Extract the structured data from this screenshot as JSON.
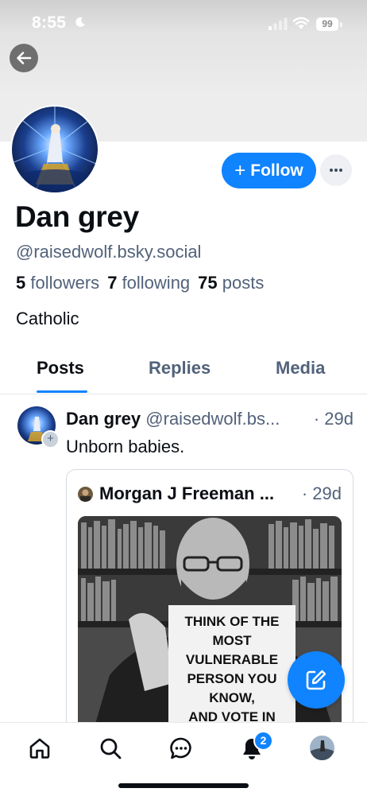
{
  "status_bar": {
    "time": "8:55",
    "battery": "99",
    "icons": [
      "moon-icon",
      "signal-icon",
      "wifi-icon",
      "battery-icon"
    ]
  },
  "header": {
    "back_icon": "arrow-left-icon"
  },
  "profile": {
    "display_name": "Dan grey",
    "handle": "@raisedwolf.bsky.social",
    "followers_count": "5",
    "followers_label": "followers",
    "following_count": "7",
    "following_label": "following",
    "posts_count": "75",
    "posts_label": "posts",
    "bio": "Catholic",
    "follow_button": {
      "icon": "+",
      "label": "Follow"
    },
    "more_icon": "ellipsis-icon"
  },
  "tabs": [
    {
      "label": "Posts",
      "active": true
    },
    {
      "label": "Replies",
      "active": false
    },
    {
      "label": "Media",
      "active": false
    }
  ],
  "feed": {
    "post": {
      "author_name": "Dan grey",
      "author_handle": "@raisedwolf.bs...",
      "time": "· 29d",
      "text": "Unborn babies.",
      "quote": {
        "author_name": "Morgan J Freeman ...",
        "time": "· 29d",
        "image_sign_lines": [
          "THINK OF THE",
          "MOST",
          "VULNERABLE",
          "PERSON YOU",
          "KNOW,",
          "AND VOTE IN"
        ]
      }
    }
  },
  "compose_icon": "compose-icon",
  "bottom_nav": {
    "items": [
      "home-icon",
      "search-icon",
      "chat-icon",
      "bell-icon",
      "profile-avatar"
    ],
    "notification_badge": "2"
  },
  "colors": {
    "accent": "#1083fe",
    "muted_text": "#52627a",
    "text": "#0b0f14",
    "banner": "#ededed"
  }
}
